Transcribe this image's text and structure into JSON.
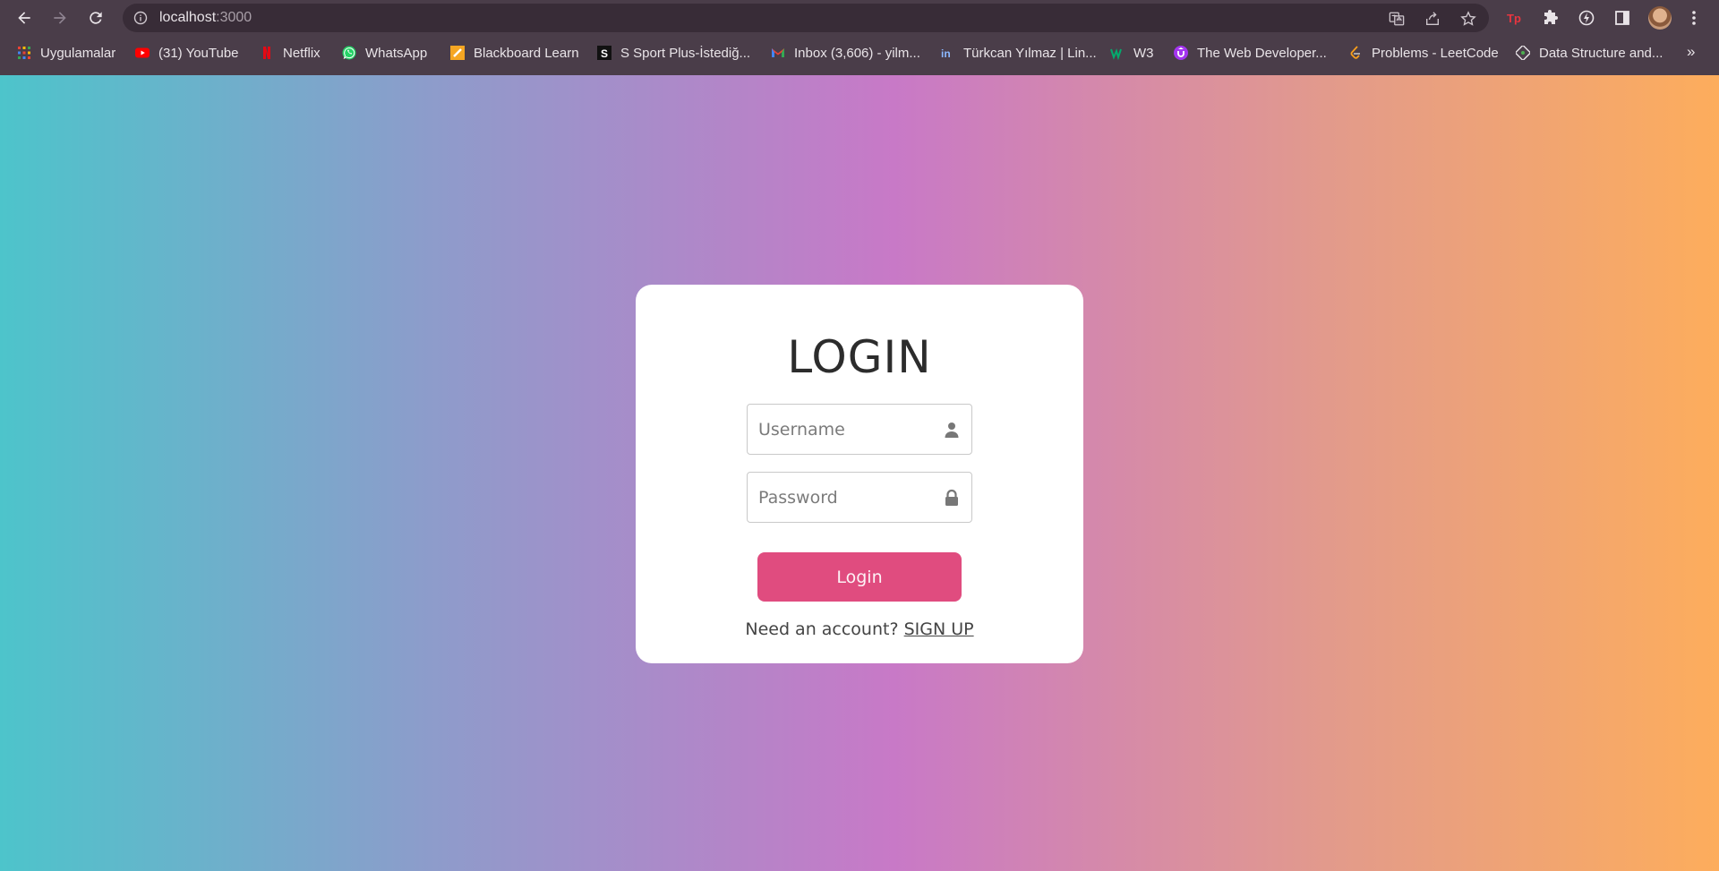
{
  "browser": {
    "url_host": "localhost",
    "url_port": ":3000",
    "bookmarks": [
      {
        "label": "Uygulamalar",
        "icon": "apps-grid-icon"
      },
      {
        "label": "(31) YouTube",
        "icon": "youtube-icon"
      },
      {
        "label": "Netflix",
        "icon": "netflix-icon"
      },
      {
        "label": "WhatsApp",
        "icon": "whatsapp-icon"
      },
      {
        "label": "Blackboard Learn",
        "icon": "blackboard-icon"
      },
      {
        "label": "S Sport Plus-İstediğ...",
        "icon": "ssport-icon"
      },
      {
        "label": "Inbox (3,606) - yilm...",
        "icon": "gmail-icon"
      },
      {
        "label": "Türkcan Yılmaz | Lin...",
        "icon": "linkedin-icon"
      },
      {
        "label": "W3",
        "icon": "w3-icon"
      },
      {
        "label": "The Web Developer...",
        "icon": "udemy-icon"
      },
      {
        "label": "Problems - LeetCode",
        "icon": "leetcode-icon"
      },
      {
        "label": "Data Structure and...",
        "icon": "datastructure-icon"
      }
    ],
    "more_label": "»"
  },
  "login": {
    "title": "LOGIN",
    "username_placeholder": "Username",
    "password_placeholder": "Password",
    "button_label": "Login",
    "signup_prompt": "Need an account?",
    "signup_link": "SIGN UP"
  },
  "colors": {
    "gradient_left": "#4dc4cb",
    "gradient_mid": "#c879c7",
    "gradient_right": "#fdad5c",
    "button": "#e04c7f",
    "card": "#ffffff"
  }
}
